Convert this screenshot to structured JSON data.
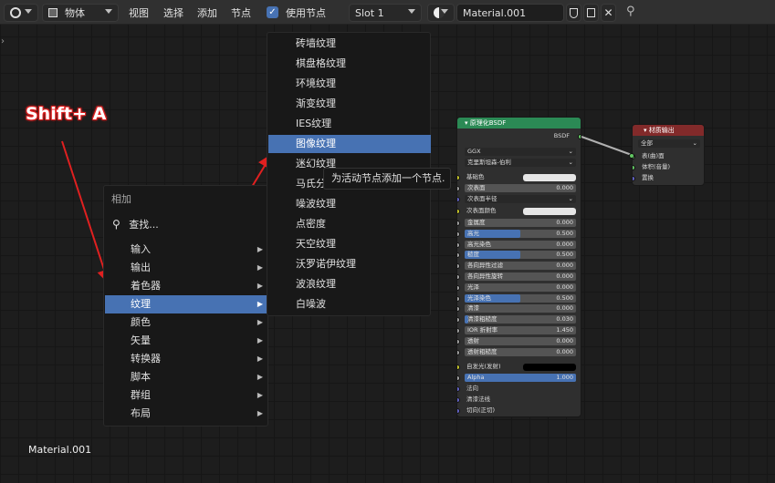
{
  "header": {
    "object_mode": "物体",
    "menus": [
      "视图",
      "选择",
      "添加",
      "节点"
    ],
    "use_nodes_label": "使用节点",
    "slot": "Slot 1",
    "material": "Material.001"
  },
  "annotation": "Shift+ A",
  "add_menu": {
    "title": "相加",
    "search": "查找...",
    "items": [
      "输入",
      "输出",
      "着色器",
      "纹理",
      "颜色",
      "矢量",
      "转换器",
      "脚本",
      "群组",
      "布局"
    ]
  },
  "texture_menu": {
    "items": [
      "砖墙纹理",
      "棋盘格纹理",
      "环境纹理",
      "渐变纹理",
      "IES纹理",
      "图像纹理",
      "迷幻纹理",
      "马氏分形纹理",
      "噪波纹理",
      "点密度",
      "天空纹理",
      "沃罗诺伊纹理",
      "波浪纹理",
      "白噪波"
    ],
    "tooltip": "为活动节点添加一个节点."
  },
  "bsdf_node": {
    "title": "原理化BSDF",
    "output": "BSDF",
    "distribution": "GGX",
    "subsurface_method": "克里斯坦森-伯利",
    "base_color": "基础色",
    "subsurface": {
      "label": "次表面",
      "value": "0.000"
    },
    "subsurface_radius": "次表面半径",
    "subsurface_color": "次表面颜色",
    "params": [
      {
        "label": "金属度",
        "value": "0.000",
        "fill": 0
      },
      {
        "label": "高光",
        "value": "0.500",
        "fill": 0.5
      },
      {
        "label": "高光染色",
        "value": "0.000",
        "fill": 0
      },
      {
        "label": "糙度",
        "value": "0.500",
        "fill": 0.5
      },
      {
        "label": "各向异性过滤",
        "value": "0.000",
        "fill": 0
      },
      {
        "label": "各向异性旋转",
        "value": "0.000",
        "fill": 0
      },
      {
        "label": "光泽",
        "value": "0.000",
        "fill": 0
      },
      {
        "label": "光泽染色",
        "value": "0.500",
        "fill": 0.5
      },
      {
        "label": "清漆",
        "value": "0.000",
        "fill": 0
      },
      {
        "label": "清漆粗糙度",
        "value": "0.030",
        "fill": 0.03
      },
      {
        "label": "IOR 折射率",
        "value": "1.450",
        "fill": 0
      },
      {
        "label": "透射",
        "value": "0.000",
        "fill": 0
      },
      {
        "label": "透射粗糙度",
        "value": "0.000",
        "fill": 0
      }
    ],
    "emission": "自发光(发射)",
    "alpha": {
      "label": "Alpha",
      "value": "1.000",
      "fill": 1
    },
    "inputs_bottom": [
      "法向",
      "清漆法线",
      "切向(正切)"
    ]
  },
  "output_node": {
    "title": "材质输出",
    "target": "全部",
    "inputs": [
      "表(曲)面",
      "体积(音量)",
      "置换"
    ]
  },
  "footer_material": "Material.001",
  "colors": {
    "accent": "#4772b3",
    "shader_header": "#2b8a55",
    "output_header": "#822a2a",
    "arrow": "#e02020"
  }
}
